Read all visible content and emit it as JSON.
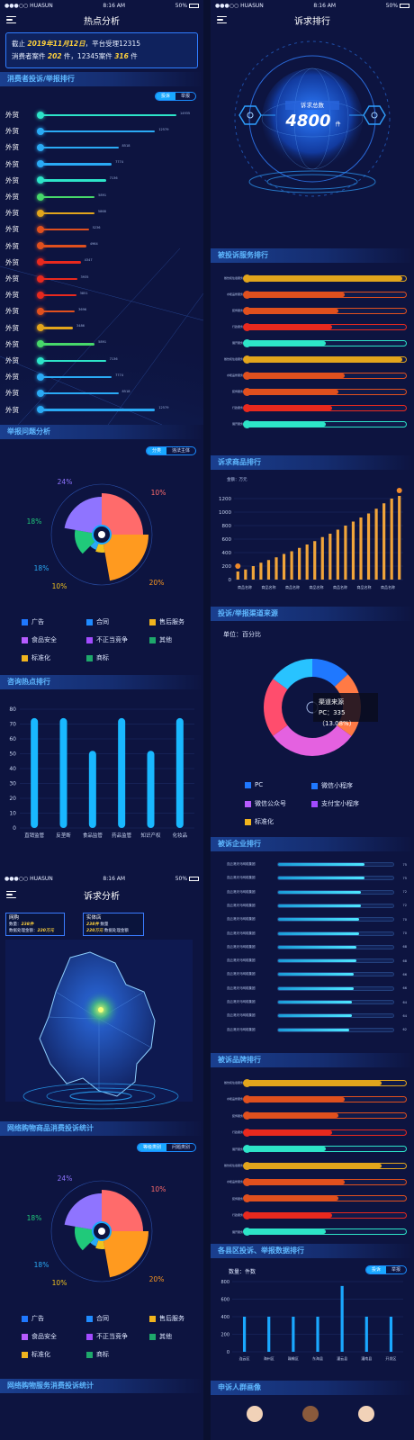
{
  "status": {
    "carrier": "●●●○○ HUASUN",
    "time": "8:16 AM",
    "battery": "50%"
  },
  "screen1": {
    "title": "热点分析",
    "notice": {
      "line1_pre": "截止 ",
      "date": "2019年11月12日",
      "line1_post": "，平台受理12315",
      "line2_pre": "消费者案件 ",
      "n12315": "202",
      "line2_mid": " 件，12345案件 ",
      "n12345": "316",
      "line2_post": " 件"
    },
    "rank_title": "消费者投诉/举报排行",
    "rank_tabs": [
      "投诉",
      "举报"
    ],
    "rank_items": [
      {
        "name": "外贸",
        "value": 14935,
        "label": "14935",
        "color": "#2de4c8"
      },
      {
        "name": "外贸",
        "value": 12579,
        "label": "12579",
        "color": "#2aaaf5"
      },
      {
        "name": "外贸",
        "value": 8518,
        "label": "8518",
        "color": "#2aaaf5"
      },
      {
        "name": "外贸",
        "value": 7774,
        "label": "7774",
        "color": "#2aaaf5"
      },
      {
        "name": "外贸",
        "value": 7136,
        "label": "7136",
        "color": "#2de4c8"
      },
      {
        "name": "外贸",
        "value": 5891,
        "label": "5891",
        "color": "#47d86a"
      },
      {
        "name": "外贸",
        "value": 5868,
        "label": "5868",
        "color": "#e2a51c"
      },
      {
        "name": "外贸",
        "value": 5236,
        "label": "5236",
        "color": "#e0501e"
      },
      {
        "name": "外贸",
        "value": 4964,
        "label": "4964",
        "color": "#e0501e"
      },
      {
        "name": "外贸",
        "value": 4347,
        "label": "4347",
        "color": "#e8291e"
      },
      {
        "name": "外贸",
        "value": 3935,
        "label": "3935",
        "color": "#e8291e"
      },
      {
        "name": "外贸",
        "value": 3851,
        "label": "3851",
        "color": "#e8291e"
      },
      {
        "name": "外贸",
        "value": 3696,
        "label": "3696",
        "color": "#e0501e"
      },
      {
        "name": "外贸",
        "value": 3486,
        "label": "3486",
        "color": "#e2a51c"
      },
      {
        "name": "外贸",
        "value": 5891,
        "label": "5891",
        "color": "#47d86a"
      },
      {
        "name": "外贸",
        "value": 7136,
        "label": "7136",
        "color": "#2de4c8"
      },
      {
        "name": "外贸",
        "value": 7774,
        "label": "7774",
        "color": "#2aaaf5"
      },
      {
        "name": "外贸",
        "value": 8518,
        "label": "8518",
        "color": "#2aaaf5"
      },
      {
        "name": "外贸",
        "value": 12579,
        "label": "12579",
        "color": "#2aaaf5"
      }
    ],
    "issue_title": "举报问题分析",
    "issue_tabs": [
      "分类",
      "违法主体"
    ],
    "pie_labels": [
      "24%",
      "10%",
      "18%",
      "18%",
      "10%",
      "20%"
    ],
    "legend": [
      {
        "label": "广告",
        "color": "#1f78ff"
      },
      {
        "label": "合同",
        "color": "#1f8bff"
      },
      {
        "label": "售后服务",
        "color": "#f0b41e"
      },
      {
        "label": "食品安全",
        "color": "#b65cff"
      },
      {
        "label": "不正当竞争",
        "color": "#a24bff"
      },
      {
        "label": "其他",
        "color": "#1ea86b"
      },
      {
        "label": "标准化",
        "color": "#f0b41e"
      },
      {
        "label": "商标",
        "color": "#1ea86b"
      }
    ],
    "consult_title": "咨询热点排行"
  },
  "screen3": {
    "title": "诉求分析",
    "tip1": {
      "name": "网购",
      "l1": "数量：",
      "v1": "238件",
      "l2": "数据处理金额：",
      "v2": "220万元"
    },
    "tip2": {
      "name": "实体店",
      "v1": "238件",
      "l1": "数量",
      "v2": "220万元",
      "l2": "数据处理金额"
    },
    "goods_title": "网络购物商品消费投诉统计",
    "goods_tabs": [
      "等级类别",
      "问题类别"
    ],
    "service_title": "网络购物服务消费投诉统计"
  },
  "screen2": {
    "title": "诉求排行",
    "total_label": "诉求总数",
    "total_value": "4800",
    "total_unit": "件",
    "svc_title": "被投诉服务排行",
    "svc_items": [
      {
        "label": "餐饮和住宿服务",
        "frac": 0.98,
        "color": "#e2a51c"
      },
      {
        "label": "水暖品修服务",
        "frac": 0.62,
        "color": "#e0501e"
      },
      {
        "label": "装饰服务",
        "frac": 0.58,
        "color": "#e0501e"
      },
      {
        "label": "行政服务",
        "frac": 0.54,
        "color": "#e8291e"
      },
      {
        "label": "展开服务",
        "frac": 0.5,
        "color": "#2de4c8"
      },
      {
        "label": "餐饮和住宿服务",
        "frac": 0.98,
        "color": "#e2a51c"
      },
      {
        "label": "水暖品修服务",
        "frac": 0.62,
        "color": "#e0501e"
      },
      {
        "label": "装饰服务",
        "frac": 0.58,
        "color": "#e0501e"
      },
      {
        "label": "行政服务",
        "frac": 0.54,
        "color": "#e8291e"
      },
      {
        "label": "展开服务",
        "frac": 0.5,
        "color": "#2de4c8"
      }
    ],
    "goods_title": "诉求商品排行",
    "goods_unit": "金额：万元",
    "channel_title": "投诉/举报渠道来源",
    "channel_unit": "单位：百分比",
    "channel_tip": {
      "title": "渠道来源",
      "text": "PC：335（13.08%）"
    },
    "channel_legend": [
      {
        "label": "PC",
        "color": "#1f78ff"
      },
      {
        "label": "微信小程序",
        "color": "#1f78ff"
      },
      {
        "label": "微信公众号",
        "color": "#b65cff"
      },
      {
        "label": "支付宝小程序",
        "color": "#a24bff"
      },
      {
        "label": "标准化",
        "color": "#f0b41e"
      }
    ],
    "enterprise_title": "被诉企业排行",
    "enterprise_items": [
      {
        "label": "连云港天马网络集团",
        "value": 75,
        "label_v": "75"
      },
      {
        "label": "连云港天马网络集团",
        "value": 75,
        "label_v": "75"
      },
      {
        "label": "连云港天马网络集团",
        "value": 72,
        "label_v": "72"
      },
      {
        "label": "连云港天马网络集团",
        "value": 72,
        "label_v": "72"
      },
      {
        "label": "连云港天马网络集团",
        "value": 70,
        "label_v": "70"
      },
      {
        "label": "连云港天马网络集团",
        "value": 70,
        "label_v": "70"
      },
      {
        "label": "连云港天马网络集团",
        "value": 68,
        "label_v": "68"
      },
      {
        "label": "连云港天马网络集团",
        "value": 68,
        "label_v": "68"
      },
      {
        "label": "连云港天马网络集团",
        "value": 66,
        "label_v": "66"
      },
      {
        "label": "连云港天马网络集团",
        "value": 66,
        "label_v": "66"
      },
      {
        "label": "连云港天马网络集团",
        "value": 64,
        "label_v": "64"
      },
      {
        "label": "连云港天马网络集团",
        "value": 64,
        "label_v": "64"
      },
      {
        "label": "连云港天马网络集团",
        "value": 62,
        "label_v": "62"
      }
    ],
    "brand_title": "被诉品牌排行",
    "brand_items": [
      {
        "label": "餐饮和住宿服务",
        "frac": 0.85,
        "color": "#e2a51c"
      },
      {
        "label": "水暖品修服务",
        "frac": 0.62,
        "color": "#e0501e"
      },
      {
        "label": "装饰服务",
        "frac": 0.58,
        "color": "#e0501e"
      },
      {
        "label": "行政服务",
        "frac": 0.54,
        "color": "#e8291e"
      },
      {
        "label": "展开服务",
        "frac": 0.5,
        "color": "#2de4c8"
      },
      {
        "label": "餐饮和住宿服务",
        "frac": 0.85,
        "color": "#e2a51c"
      },
      {
        "label": "水暖品修服务",
        "frac": 0.62,
        "color": "#e0501e"
      },
      {
        "label": "装饰服务",
        "frac": 0.58,
        "color": "#e0501e"
      },
      {
        "label": "行政服务",
        "frac": 0.54,
        "color": "#e8291e"
      },
      {
        "label": "展开服务",
        "frac": 0.5,
        "color": "#2de4c8"
      }
    ],
    "district_title": "各县区投诉、举报数据排行",
    "district_unit": "数量：件数",
    "district_tabs": [
      "投诉",
      "举报"
    ],
    "crowd_title": "申诉人群画像"
  },
  "chart_data": [
    {
      "type": "bar",
      "categories": [
        "直销监管",
        "反垄断",
        "食品监管",
        "药品监管",
        "知识产权",
        "化妆品"
      ],
      "values": [
        74,
        74,
        52,
        74,
        52,
        74
      ],
      "ylim": [
        0,
        80
      ],
      "yticks": [
        0,
        10,
        20,
        30,
        40,
        50,
        60,
        70,
        80
      ]
    },
    {
      "type": "bar",
      "categories": [
        "商品名称",
        "商品名称",
        "商品名称",
        "商品名称",
        "商品名称",
        "商品名称",
        "商品名称",
        "商品名称",
        "商品名称",
        "商品名称",
        "商品名称",
        "商品名称",
        "商品名称",
        "商品名称",
        "商品名称",
        "商品名称",
        "商品名称",
        "商品名称",
        "商品名称",
        "商品名称"
      ],
      "x_labels": [
        "商品名称",
        "商品名称",
        "商品名称",
        "商品名称",
        "商品名称",
        "商品名称",
        "商品名称"
      ],
      "values": [
        120,
        150,
        200,
        250,
        290,
        330,
        380,
        420,
        470,
        520,
        570,
        630,
        680,
        740,
        800,
        860,
        920,
        980,
        1050,
        1130,
        1200,
        1240
      ],
      "ylim": [
        0,
        1200
      ],
      "yticks": [
        0,
        200,
        400,
        600,
        800,
        1000,
        1200
      ]
    },
    {
      "type": "pie",
      "labels": [
        "PC",
        "微信小程序",
        "微信公众号",
        "支付宝小程序",
        "标准化"
      ],
      "values": [
        13.08,
        22,
        30,
        20,
        15
      ],
      "colors": [
        "#1f78ff",
        "#ff7a45",
        "#e461e0",
        "#ff4d6d",
        "#28c3ff"
      ]
    },
    {
      "type": "bar",
      "categories": [
        "连云区",
        "海州区",
        "赣榆区",
        "东海县",
        "灌云县",
        "灌南县",
        "开发区"
      ],
      "values": [
        400,
        400,
        400,
        400,
        750,
        400,
        400
      ],
      "ylim": [
        0,
        800
      ],
      "yticks": [
        0,
        200,
        400,
        600,
        800
      ]
    }
  ]
}
